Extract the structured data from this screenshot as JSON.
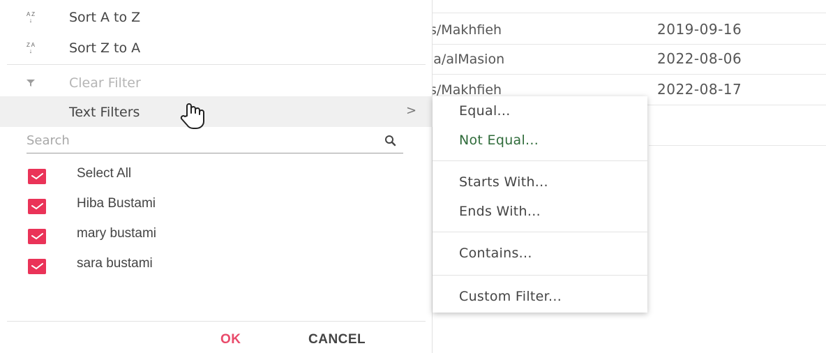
{
  "grid": {
    "rows": [
      {
        "name": "s/Makhfieh",
        "date": "2019-09-16"
      },
      {
        "name": "la/alMasion",
        "date": "2022-08-06"
      },
      {
        "name": "s/Makhfieh",
        "date": "2022-08-17"
      }
    ]
  },
  "filter_menu": {
    "sort_asc": {
      "label": "Sort A to Z",
      "icon": "sort-asc-icon",
      "glyph_top": "A Z",
      "glyph_bottom": "↓"
    },
    "sort_desc": {
      "label": "Sort Z to A",
      "icon": "sort-desc-icon",
      "glyph_top": "Z A",
      "glyph_bottom": "↓"
    },
    "clear_filter": {
      "label": "Clear Filter",
      "icon": "filter-icon"
    },
    "text_filters": {
      "label": "Text Filters",
      "arrow": ">"
    },
    "search": {
      "placeholder": "Search",
      "value": ""
    },
    "checklist": [
      {
        "label": "Select All",
        "checked": true
      },
      {
        "label": "Hiba Bustami",
        "checked": true
      },
      {
        "label": "mary bustami",
        "checked": true
      },
      {
        "label": "sara bustami",
        "checked": true
      }
    ],
    "buttons": {
      "ok": "OK",
      "cancel": "CANCEL"
    }
  },
  "submenu": {
    "items": [
      {
        "label": "Equal..."
      },
      {
        "label": "Not Equal..."
      },
      {
        "label": "Starts With..."
      },
      {
        "label": "Ends With..."
      },
      {
        "label": "Contains..."
      },
      {
        "label": "Custom Filter..."
      }
    ]
  },
  "colors": {
    "accent": "#ea3358",
    "ok_text": "#e94a6a",
    "hover_bg": "#f0f0f0"
  }
}
